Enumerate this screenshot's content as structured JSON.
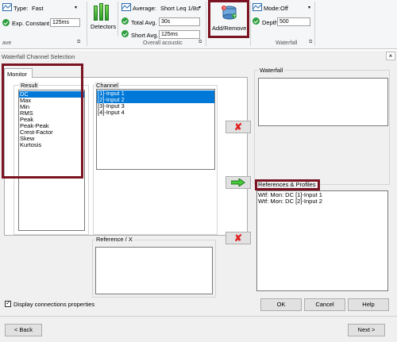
{
  "ribbon": {
    "type_label": "Type:",
    "type_value": "Fast",
    "exp_label": "Exp. Constant",
    "exp_value": "125ms",
    "group1_label": "ave",
    "detectors_label": "Detectors",
    "average_label": "Average:",
    "average_value": "Short Leq 1/8s",
    "total_avg_label": "Total Avg.",
    "total_avg_value": "30s",
    "short_avg_label": "Short Avg.",
    "short_avg_value": "125ms",
    "group2_label": "Overall acoustic",
    "add_remove_label": "Add/Remove",
    "mode_label": "Mode:",
    "mode_value": "Off",
    "depth_label": "Depth",
    "depth_value": "500",
    "group3_label": "Waterfall",
    "accent_highlight": "#7a1422"
  },
  "dialog": {
    "title": "Waterfall Channel Selection",
    "tab_monitor": "Monitor",
    "result_label": "Result",
    "result_items": [
      "DC",
      "Max",
      "Min",
      "RMS",
      "Peak",
      "Peak-Peak",
      "Crest-Factor",
      "Skew",
      "Kurtosis"
    ],
    "channel_label": "Channel",
    "channel_items": [
      "[1]-Input 1",
      "[2]-Input 2",
      "[3]-Input 3",
      "[4]-Input 4"
    ],
    "reference_label": "Reference / X",
    "waterfall_label": "Waterfall",
    "refs_label": "References & Profiles",
    "refs_items": [
      "Wtf: Mon: DC [1]-Input 1",
      "Wtf: Mon: DC [2]-Input 2"
    ],
    "display_conn_label": "Display connections properties",
    "display_conn_checked": true,
    "ok_label": "OK",
    "cancel_label": "Cancel",
    "help_label": "Help",
    "back_label": "< Back",
    "next_label": "Next >"
  }
}
